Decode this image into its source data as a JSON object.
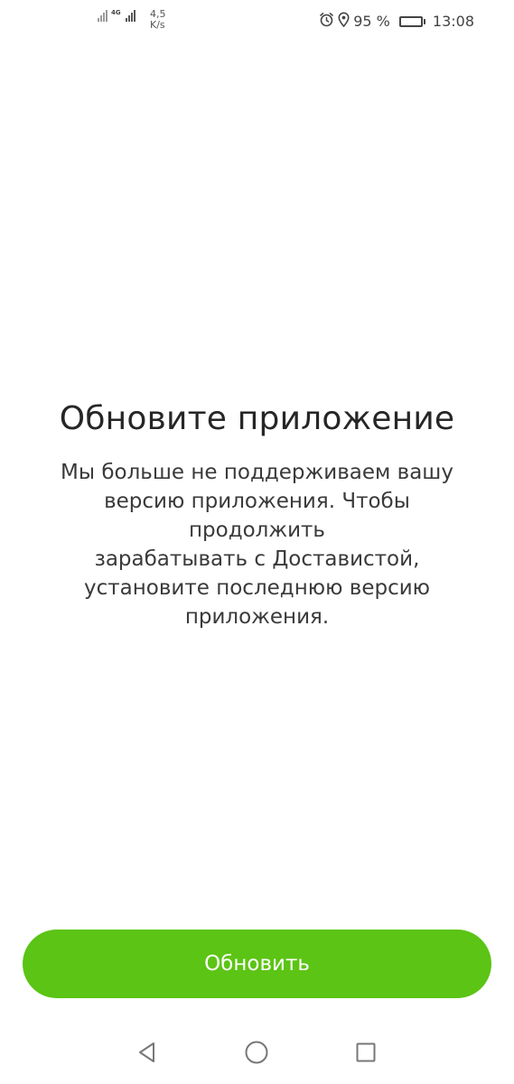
{
  "status_bar": {
    "network_type": "4G",
    "speed_value": "4,5",
    "speed_unit": "K/s",
    "battery_percent": "95 %",
    "battery_level": 0.95,
    "time": "13:08",
    "icons": [
      "signal-icon",
      "alarm-icon",
      "location-icon",
      "battery-icon"
    ]
  },
  "main": {
    "title": "Обновите приложение",
    "description_lines": [
      "Мы больше не поддерживаем вашу",
      "версию приложения. Чтобы продолжить",
      "зарабатывать с Доставистой,",
      "установите последнюю версию",
      "приложения."
    ]
  },
  "actions": {
    "update_label": "Обновить"
  },
  "nav": {
    "icons": [
      "back-icon",
      "home-icon",
      "recents-icon"
    ]
  },
  "colors": {
    "accent": "#5bc414",
    "background": "#ffffff",
    "text": "#262626"
  }
}
